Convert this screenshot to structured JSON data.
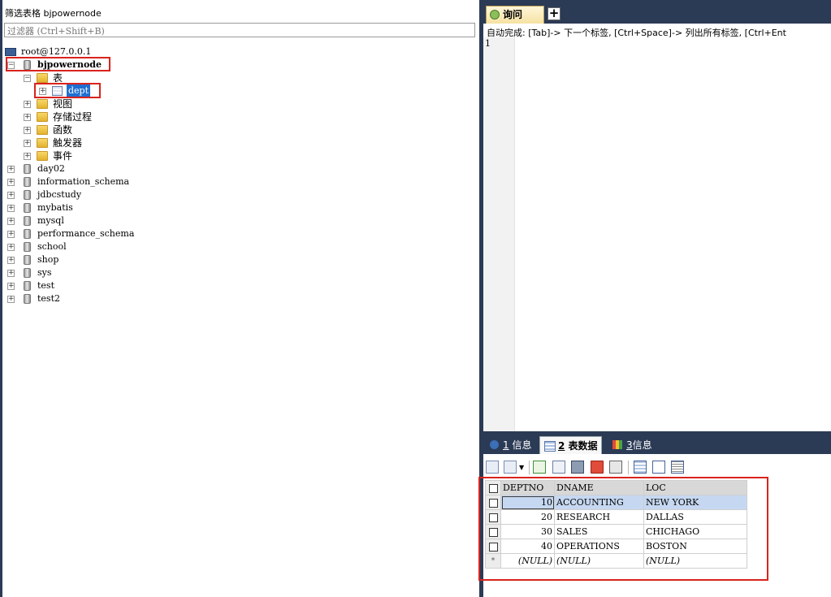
{
  "left": {
    "filter_label": "筛选表格 bjpowernode",
    "filter_placeholder": "过滤器 (Ctrl+Shift+B)",
    "server": "root@127.0.0.1",
    "current_db": "bjpowernode",
    "tables_folder": "表",
    "table": "dept",
    "folders": [
      "视图",
      "存储过程",
      "函数",
      "触发器",
      "事件"
    ],
    "databases": [
      "day02",
      "information_schema",
      "jdbcstudy",
      "mybatis",
      "mysql",
      "performance_schema",
      "school",
      "shop",
      "sys",
      "test",
      "test2"
    ]
  },
  "query": {
    "tab_label": "询问",
    "add_tab": "+",
    "hint": "自动完成: [Tab]-> 下一个标签, [Ctrl+Space]-> 列出所有标签, [Ctrl+Ent",
    "line_number": "1"
  },
  "results": {
    "tabs": [
      {
        "num": "1",
        "label": "信息"
      },
      {
        "num": "2",
        "label": "表数据"
      },
      {
        "num": "3",
        "label": "信息"
      }
    ],
    "columns": [
      "DEPTNO",
      "DNAME",
      "LOC"
    ],
    "rows": [
      [
        "10",
        "ACCOUNTING",
        "NEW YORK"
      ],
      [
        "20",
        "RESEARCH",
        "DALLAS"
      ],
      [
        "30",
        "SALES",
        "CHICHAGO"
      ],
      [
        "40",
        "OPERATIONS",
        "BOSTON"
      ]
    ],
    "new_row": [
      "(NULL)",
      "(NULL)",
      "(NULL)"
    ],
    "new_row_marker": "*"
  },
  "colors": {
    "panel_dark": "#2b3a55",
    "highlight_red": "#d9231d",
    "selection_blue": "#1f6fd1"
  }
}
